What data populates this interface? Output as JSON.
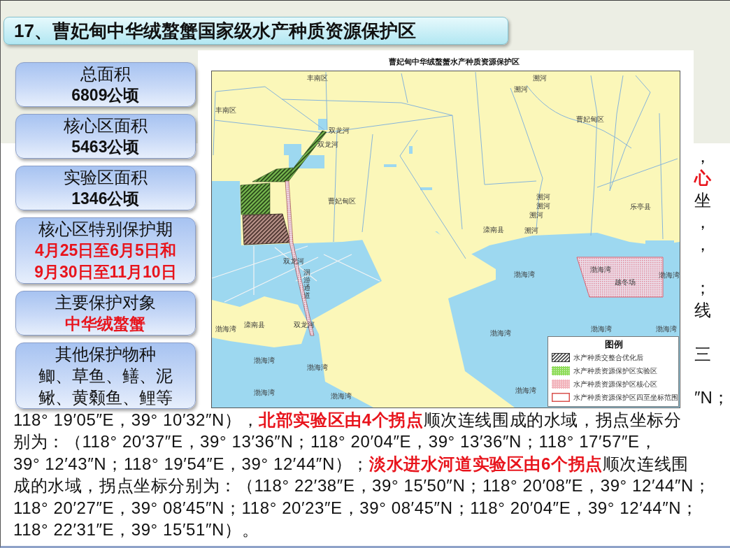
{
  "title_bar": {
    "text": "17、曹妃甸中华绒螯蟹国家级水产种质资源保护区"
  },
  "info_boxes": [
    {
      "heading": "总面积",
      "detail_lines": [
        "6809公顷"
      ],
      "kind": "value"
    },
    {
      "heading": "核心区面积",
      "detail_lines": [
        "5463公顷"
      ],
      "kind": "value"
    },
    {
      "heading": "实验区面积",
      "detail_lines": [
        "1346公顷"
      ],
      "kind": "value"
    },
    {
      "heading": "核心区特别保护期",
      "detail_lines": [
        "4月25日至6月5日和",
        "9月30日至11月10日"
      ],
      "kind": "alert"
    },
    {
      "heading": "主要保护对象",
      "detail_lines": [
        "中华绒螯蟹"
      ],
      "kind": "alert"
    },
    {
      "heading": "其他保护物种",
      "detail_lines": [
        "鲫、草鱼、鳝、泥",
        "鳅、黄颡鱼、鲤等"
      ],
      "kind": "plain"
    }
  ],
  "map": {
    "title": "曹妃甸中华绒螯蟹水产种质资源保护区",
    "place_labels": [
      {
        "text": "丰南区",
        "kind": "horizontal"
      },
      {
        "text": "丰南区",
        "kind": "horizontal"
      },
      {
        "text": "曹妃甸区",
        "kind": "horizontal"
      },
      {
        "text": "双龙河",
        "kind": "horizontal"
      },
      {
        "text": "双龙河",
        "kind": "horizontal"
      },
      {
        "text": "曹妃甸区",
        "kind": "horizontal"
      },
      {
        "text": "溯河",
        "kind": "horizontal"
      },
      {
        "text": "溯河",
        "kind": "horizontal"
      },
      {
        "text": "溯河",
        "kind": "horizontal"
      },
      {
        "text": "溯河",
        "kind": "horizontal"
      },
      {
        "text": "溯河",
        "kind": "horizontal"
      },
      {
        "text": "溯河",
        "kind": "horizontal"
      },
      {
        "text": "滦南县",
        "kind": "horizontal"
      },
      {
        "text": "乐亭县",
        "kind": "horizontal"
      },
      {
        "text": "双龙河",
        "kind": "horizontal"
      },
      {
        "text": "渤海湾",
        "kind": "horizontal"
      },
      {
        "text": "渤海湾",
        "kind": "horizontal"
      },
      {
        "text": "越冬场",
        "kind": "horizontal"
      },
      {
        "text": "渤海湾",
        "kind": "horizontal"
      },
      {
        "text": "滦南县",
        "kind": "horizontal"
      },
      {
        "text": "双龙河",
        "kind": "horizontal"
      },
      {
        "text": "渤海湾",
        "kind": "horizontal"
      },
      {
        "text": "渤海湾",
        "kind": "horizontal"
      },
      {
        "text": "渤海湾",
        "kind": "horizontal"
      },
      {
        "text": "渤海湾",
        "kind": "horizontal"
      },
      {
        "text": "渤海湾",
        "kind": "horizontal"
      },
      {
        "text": "渤海湾",
        "kind": "horizontal"
      },
      {
        "text": "渤海湾",
        "kind": "horizontal"
      },
      {
        "text": "渤海湾",
        "kind": "horizontal"
      },
      {
        "text": "渤海湾",
        "kind": "horizontal"
      },
      {
        "text": "洄游通道",
        "kind": "vertical"
      }
    ],
    "legend": {
      "title": "图例",
      "items": [
        {
          "label": "水产种质交整合优化后",
          "kind": "hatch",
          "color": "#333333"
        },
        {
          "label": "水产种质资源保护区实验区",
          "kind": "dots",
          "color": "#8fdc5a"
        },
        {
          "label": "水产种质资源保护区核心区",
          "kind": "dots",
          "color": "#f2b4bc"
        },
        {
          "label": "水产种质资源保护区四至坐标范围",
          "kind": "outline",
          "color": "#d9534f"
        }
      ]
    }
  },
  "body_text": {
    "right_edge_fragments": [
      {
        "text": "，",
        "kind": "plain"
      },
      {
        "text": "心",
        "kind": "highlight"
      },
      {
        "text": "坐",
        "kind": "plain"
      },
      {
        "text": "，",
        "kind": "plain"
      },
      {
        "text": "，",
        "kind": "plain"
      },
      {
        "text": "；",
        "kind": "plain"
      },
      {
        "text": "线",
        "kind": "plain"
      },
      {
        "text": "三",
        "kind": "plain"
      },
      {
        "text": "″N；",
        "kind": "plain"
      }
    ],
    "lines": [
      "118° 19′05″E，39° 10′32″N），**北部实验区由4个拐点**顺次连线围成的水域，拐点坐标分",
      "别为：（118° 20′37″E，39° 13′36″N；118° 20′04″E，39° 13′36″N；118° 17′57″E，",
      "39° 12′43″N；118° 19′54″E，39° 12′44″N）；**淡水进水河道实验区由6个拐点**顺次连线围",
      "成的水域，拐点坐标分别为：（118° 22′38″E，39° 15′50″N；118° 20′08″E，39° 12′44″N；",
      "118° 20′27″E，39° 08′45″N；118° 20′23″E，39° 08′45″N；118° 20′04″E，39° 12′44″N；",
      "118° 22′31″E，39° 15′51″N）。"
    ]
  }
}
